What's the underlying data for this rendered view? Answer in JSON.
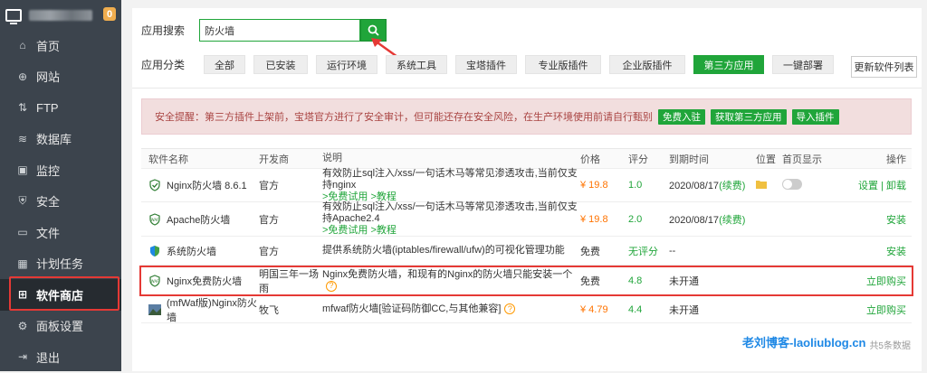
{
  "sidebar": {
    "badge": "0",
    "items": [
      {
        "label": "首页",
        "icon": "home-icon",
        "glyph": "⌂"
      },
      {
        "label": "网站",
        "icon": "globe-icon",
        "glyph": "⊕"
      },
      {
        "label": "FTP",
        "icon": "ftp-icon",
        "glyph": "⇅"
      },
      {
        "label": "数据库",
        "icon": "database-icon",
        "glyph": "≋"
      },
      {
        "label": "监控",
        "icon": "monitor-icon",
        "glyph": "▣"
      },
      {
        "label": "安全",
        "icon": "shield-icon",
        "glyph": "⛨"
      },
      {
        "label": "文件",
        "icon": "folder-icon",
        "glyph": "▭"
      },
      {
        "label": "计划任务",
        "icon": "calendar-icon",
        "glyph": "▦"
      },
      {
        "label": "软件商店",
        "icon": "apps-icon",
        "glyph": "⊞"
      },
      {
        "label": "面板设置",
        "icon": "gear-icon",
        "glyph": "⚙"
      },
      {
        "label": "退出",
        "icon": "logout-icon",
        "glyph": "⇥"
      }
    ]
  },
  "search": {
    "label": "应用搜索",
    "value": "防火墙"
  },
  "categories": {
    "label": "应用分类",
    "items": [
      "全部",
      "已安装",
      "运行环境",
      "系统工具",
      "宝塔插件",
      "专业版插件",
      "企业版插件",
      "第三方应用",
      "一键部署"
    ],
    "active": "第三方应用",
    "refresh": "更新软件列表"
  },
  "warning": {
    "text": "安全提醒：第三方插件上架前，宝塔官方进行了安全审计，但可能还存在安全风险，在生产环境使用前请自行甄别",
    "buttons": [
      "免费入驻",
      "获取第三方应用",
      "导入插件"
    ]
  },
  "table": {
    "headers": [
      "软件名称",
      "开发商",
      "说明",
      "价格",
      "评分",
      "到期时间",
      "位置",
      "首页显示",
      "操作"
    ],
    "rows": [
      {
        "name": "Nginx防火墙 8.6.1",
        "dev": "官方",
        "desc": "有效防止sql注入/xss/一句话木马等常见渗透攻击,当前仅支持nginx",
        "desc_links": ">免费试用 >教程",
        "price": "¥ 19.8",
        "score": "1.0",
        "expire": "2020/08/17",
        "renew": "(续费)",
        "op1": "设置",
        "op_sep": "|",
        "op2": "卸载"
      },
      {
        "name": "Apache防火墙",
        "dev": "官方",
        "desc": "有效防止sql注入/xss/一句话木马等常见渗透攻击,当前仅支持Apache2.4",
        "desc_links": ">免费试用 >教程",
        "price": "¥ 19.8",
        "score": "2.0",
        "expire": "2020/08/17",
        "renew": "(续费)",
        "op": "安装"
      },
      {
        "name": "系统防火墙",
        "dev": "官方",
        "desc": "提供系统防火墙(iptables/firewall/ufw)的可视化管理功能",
        "price": "免费",
        "score": "无评分",
        "expire": "--",
        "op": "安装"
      },
      {
        "name": "Nginx免费防火墙",
        "dev": "明国三年一场雨",
        "desc": "Nginx免费防火墙，和现有的Nginx的防火墙只能安装一个",
        "q": "?",
        "price": "免费",
        "score": "4.8",
        "expire": "未开通",
        "op": "立即购买"
      },
      {
        "name": "(mfWaf版)Nginx防火墙",
        "dev": "牧飞",
        "desc": "mfwaf防火墙[验证码防御CC,与其他兼容]",
        "q": "?",
        "price": "¥ 4.79",
        "score": "4.4",
        "expire": "未开通",
        "op": "立即购买"
      }
    ]
  },
  "watermark": {
    "text": "老刘博客-laoliublog.cn",
    "count": "共5条数据"
  },
  "colors": {
    "accent": "#20a53a",
    "danger": "#e53935",
    "price": "#ff7300"
  }
}
